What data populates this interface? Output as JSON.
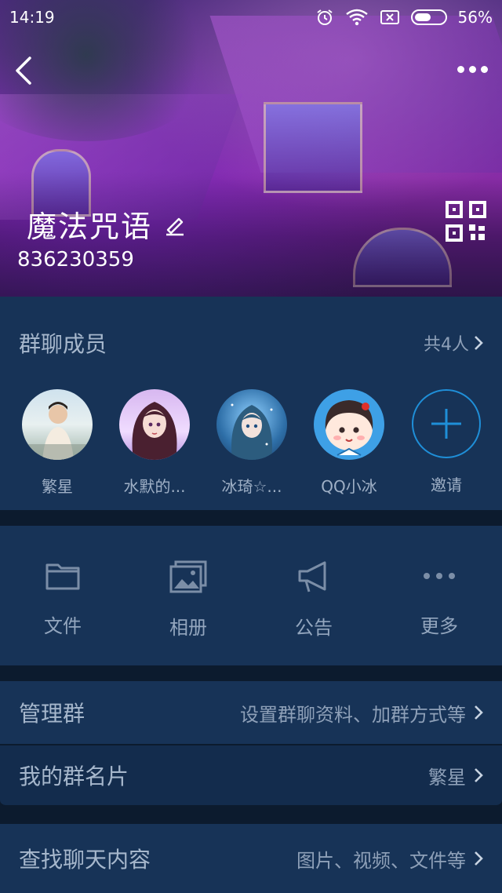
{
  "statusbar": {
    "time": "14:19",
    "battery": "56%",
    "battery_level": 0.56
  },
  "header": {
    "group_name": "魔法咒语",
    "group_id": "836230359"
  },
  "members": {
    "title": "群聊成员",
    "count": "共4人",
    "list": [
      {
        "name": "繁星"
      },
      {
        "name": "水默的..."
      },
      {
        "name": "冰琦☆..."
      },
      {
        "name": "QQ小冰"
      }
    ],
    "invite_label": "邀请"
  },
  "tools": [
    {
      "label": "文件",
      "icon": "folder-icon"
    },
    {
      "label": "相册",
      "icon": "album-icon"
    },
    {
      "label": "公告",
      "icon": "megaphone-icon"
    },
    {
      "label": "更多",
      "icon": "more-dots-icon"
    }
  ],
  "rows": {
    "manage": {
      "title": "管理群",
      "value": "设置群聊资料、加群方式等"
    },
    "card": {
      "title": "我的群名片",
      "value": "繁星"
    },
    "search": {
      "title": "查找聊天内容",
      "value": "图片、视频、文件等"
    }
  },
  "colors": {
    "accent": "#1f8fd8",
    "panel": "#173357",
    "background": "#0c1b2e"
  }
}
